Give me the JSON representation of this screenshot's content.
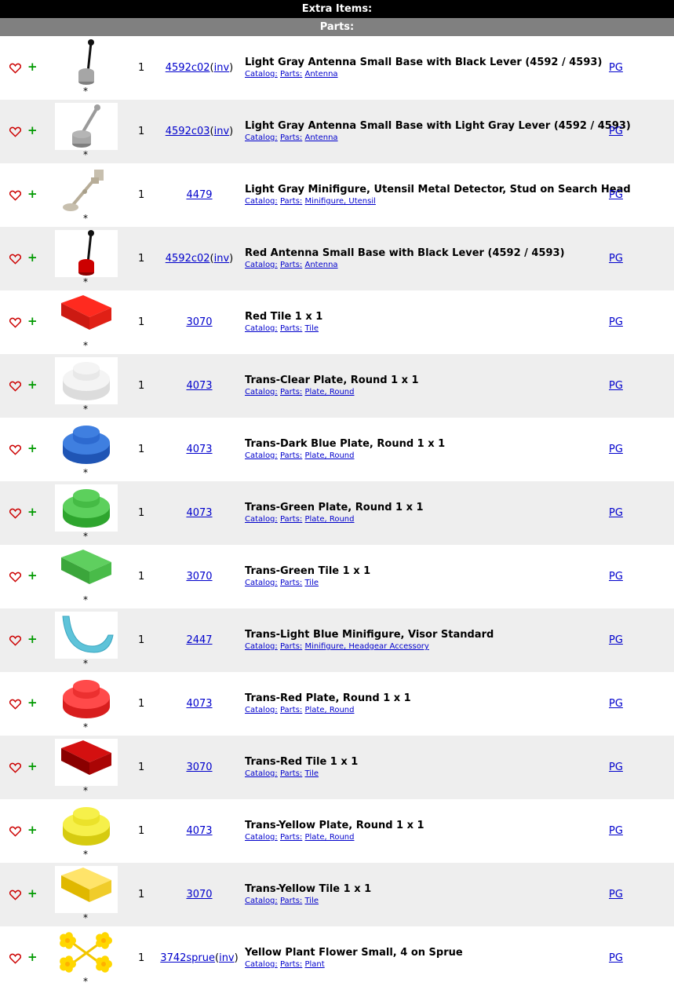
{
  "header": {
    "title": "Extra Items:",
    "subtitle": "Parts:"
  },
  "labels": {
    "catalog": "Catalog:",
    "parts": "Parts:",
    "star": "*",
    "inv": "inv",
    "pg": "PG"
  },
  "colors": {
    "plus": "#009900",
    "heart": "#cc0000",
    "link": "#0000cc"
  },
  "items": [
    {
      "qty": "1",
      "item_no": "4592c02",
      "has_inv": true,
      "title": "Light Gray Antenna Small Base with Black Lever (4592 / 4593)",
      "category": "Antenna",
      "image": "antenna-black-lever-gray-base"
    },
    {
      "qty": "1",
      "item_no": "4592c03",
      "has_inv": true,
      "title": "Light Gray Antenna Small Base with Light Gray Lever (4592 / 4593)",
      "category": "Antenna",
      "image": "antenna-gray-lever-gray-base"
    },
    {
      "qty": "1",
      "item_no": "4479",
      "has_inv": false,
      "title": "Light Gray Minifigure, Utensil Metal Detector, Stud on Search Head",
      "category": "Minifigure, Utensil",
      "image": "metal-detector"
    },
    {
      "qty": "1",
      "item_no": "4592c02",
      "has_inv": true,
      "title": "Red Antenna Small Base with Black Lever (4592 / 4593)",
      "category": "Antenna",
      "image": "antenna-black-lever-red-base"
    },
    {
      "qty": "1",
      "item_no": "3070",
      "has_inv": false,
      "title": "Red Tile 1 x 1",
      "category": "Tile",
      "image": "tile-red"
    },
    {
      "qty": "1",
      "item_no": "4073",
      "has_inv": false,
      "title": "Trans-Clear Plate, Round 1 x 1",
      "category": "Plate, Round",
      "image": "round-plate-clear"
    },
    {
      "qty": "1",
      "item_no": "4073",
      "has_inv": false,
      "title": "Trans-Dark Blue Plate, Round 1 x 1",
      "category": "Plate, Round",
      "image": "round-plate-blue"
    },
    {
      "qty": "1",
      "item_no": "4073",
      "has_inv": false,
      "title": "Trans-Green Plate, Round 1 x 1",
      "category": "Plate, Round",
      "image": "round-plate-green"
    },
    {
      "qty": "1",
      "item_no": "3070",
      "has_inv": false,
      "title": "Trans-Green Tile 1 x 1",
      "category": "Tile",
      "image": "tile-green"
    },
    {
      "qty": "1",
      "item_no": "2447",
      "has_inv": false,
      "title": "Trans-Light Blue Minifigure, Visor Standard",
      "category": "Minifigure, Headgear Accessory",
      "image": "visor-light-blue"
    },
    {
      "qty": "1",
      "item_no": "4073",
      "has_inv": false,
      "title": "Trans-Red Plate, Round 1 x 1",
      "category": "Plate, Round",
      "image": "round-plate-red"
    },
    {
      "qty": "1",
      "item_no": "3070",
      "has_inv": false,
      "title": "Trans-Red Tile 1 x 1",
      "category": "Tile",
      "image": "tile-trans-red"
    },
    {
      "qty": "1",
      "item_no": "4073",
      "has_inv": false,
      "title": "Trans-Yellow Plate, Round 1 x 1",
      "category": "Plate, Round",
      "image": "round-plate-yellow"
    },
    {
      "qty": "1",
      "item_no": "3070",
      "has_inv": false,
      "title": "Trans-Yellow Tile 1 x 1",
      "category": "Tile",
      "image": "tile-yellow"
    },
    {
      "qty": "1",
      "item_no": "3742sprue",
      "has_inv": true,
      "title": "Yellow Plant Flower Small, 4 on Sprue",
      "category": "Plant",
      "image": "flower-sprue-yellow"
    }
  ]
}
